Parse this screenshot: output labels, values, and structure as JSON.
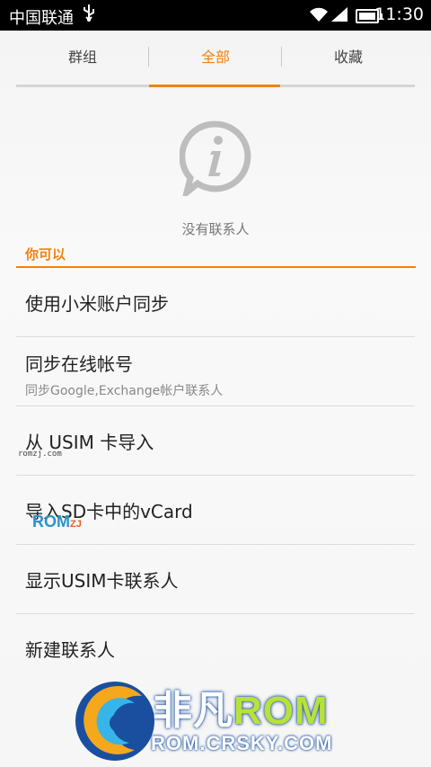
{
  "status_bar": {
    "carrier": "中国联通",
    "usb_icon": "usb-icon",
    "time": "11:30"
  },
  "tabs": [
    {
      "label": "群组",
      "active": false
    },
    {
      "label": "全部",
      "active": true
    },
    {
      "label": "收藏",
      "active": false
    }
  ],
  "empty_state": {
    "icon": "info-bubble-icon",
    "text": "没有联系人"
  },
  "section": {
    "title": "你可以"
  },
  "actions": [
    {
      "label": "使用小米账户同步",
      "sub": ""
    },
    {
      "label": "同步在线帐号",
      "sub": "同步Google,Exchange帐户联系人"
    },
    {
      "label": "从 USIM 卡导入",
      "sub": ""
    },
    {
      "label": "导入SD卡中的vCard",
      "sub": ""
    },
    {
      "label": "显示USIM卡联系人",
      "sub": ""
    },
    {
      "label": "新建联系人",
      "sub": ""
    }
  ],
  "watermarks": {
    "small": "romzj.com",
    "rom_prefix": "ROM",
    "rom_suffix": "ZJ",
    "brand_cn": "非凡",
    "brand_rom": "ROM",
    "brand_url": "ROM.CRSKY.COM"
  },
  "colors": {
    "accent": "#f2810f",
    "background": "#f6f6f6"
  }
}
